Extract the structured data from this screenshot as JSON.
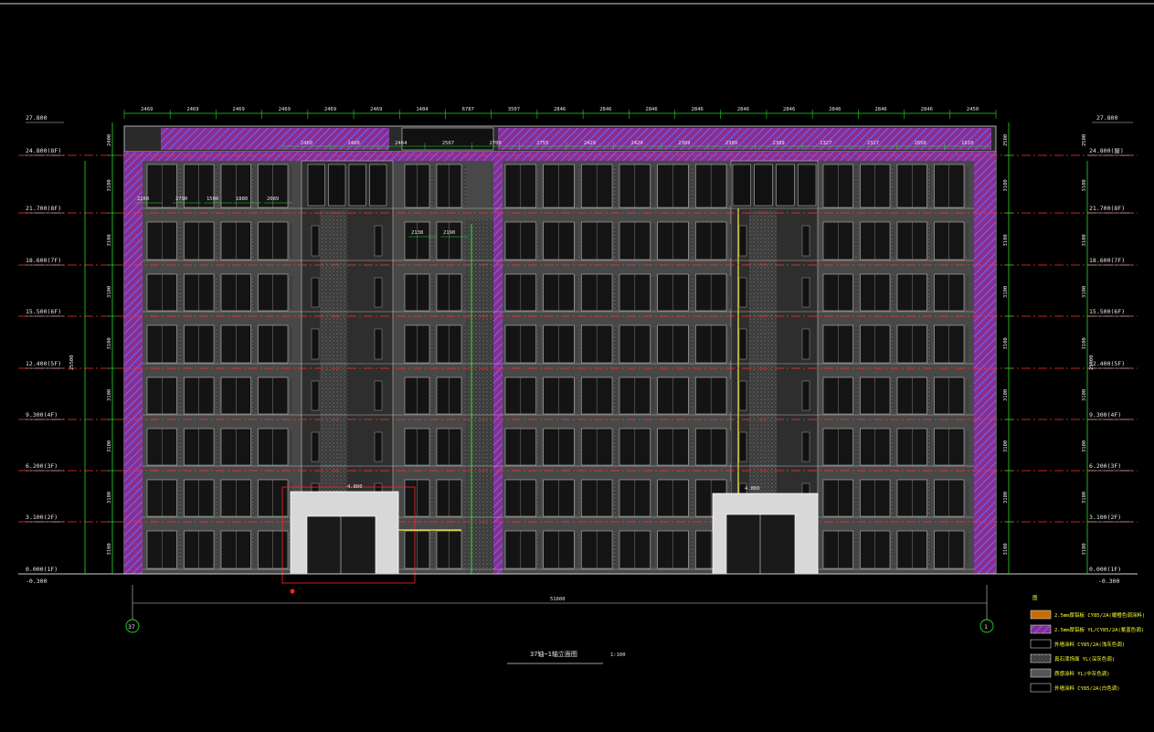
{
  "drawing": {
    "top_left_level": "27.800",
    "top_right_level": "27.800",
    "bottom_left_level": "-0.300",
    "bottom_right_level": "-0.300",
    "total_width_dim": "51600",
    "total_height_left": "25500",
    "total_height_right": "25500",
    "axis_left": "37",
    "axis_right": "1",
    "title": "37轴~1轴立面图",
    "scale": "1:100",
    "entrance_left_level": "4.800",
    "entrance_right_level": "4.800"
  },
  "floor_levels_left": [
    "24.800(8F)",
    "21.700(8F)",
    "18.600(7F)",
    "15.500(6F)",
    "12.400(5F)",
    "9.300(4F)",
    "6.200(3F)",
    "3.100(2F)",
    "0.000(1F)"
  ],
  "floor_levels_right": [
    "24.800(屋)",
    "21.700(8F)",
    "18.600(7F)",
    "15.500(6F)",
    "12.400(5F)",
    "9.300(4F)",
    "6.200(3F)",
    "3.100(2F)",
    "0.000(1F)"
  ],
  "floor_heights_left": [
    "2400",
    "3100",
    "3100",
    "3100",
    "3100",
    "3100",
    "3100",
    "3100",
    "3100"
  ],
  "floor_heights_right": [
    "2500",
    "3100",
    "3100",
    "3100",
    "3100",
    "3100",
    "3100",
    "3100",
    "3100"
  ],
  "top_dims": [
    "2469",
    "2469",
    "2469",
    "2469",
    "2469",
    "2469",
    "1484",
    "6787",
    "3507",
    "2846",
    "2846",
    "2846",
    "2846",
    "2846",
    "2846",
    "2846",
    "2846",
    "2846",
    "2450"
  ],
  "second_dims": [
    "2460",
    "2460",
    "2464",
    "2567",
    "2700",
    "2755",
    "2429",
    "2429",
    "2389",
    "2389",
    "2389",
    "2327",
    "2327",
    "2850",
    "1610"
  ],
  "small_dims": [
    "2260",
    "2790",
    "1500",
    "1880",
    "2089",
    "2138",
    "2190"
  ],
  "legend": {
    "header": "图",
    "items": [
      {
        "label": "2.5mm厚铝板 CY85/2A(暖橙色调涂料)",
        "color": "#c86c00"
      },
      {
        "label": "2.5mm厚铝板 YL/CY85/2A(紫蓝色调)",
        "color": "#7a5cff"
      },
      {
        "label": "外墙涂料 CY85/2A(浅灰色调)",
        "color": "#000000"
      },
      {
        "label": "真石漆饰面 YL(深灰色调)",
        "color": "#9a9a9a"
      },
      {
        "label": "质感涂料 YL(中灰色调)",
        "color": "#555555"
      },
      {
        "label": "外墙涂料 CY85/2A(白色调)",
        "color": "#000000"
      }
    ]
  },
  "colors": {
    "background": "#000000",
    "facade": "#4a4a4a",
    "hatch": "#c04ac8",
    "hatch_line": "#6a6aff",
    "level_line": "#ff3333",
    "dim_line": "#22dd22",
    "window": "#151515",
    "frame": "#cfcfcf"
  }
}
